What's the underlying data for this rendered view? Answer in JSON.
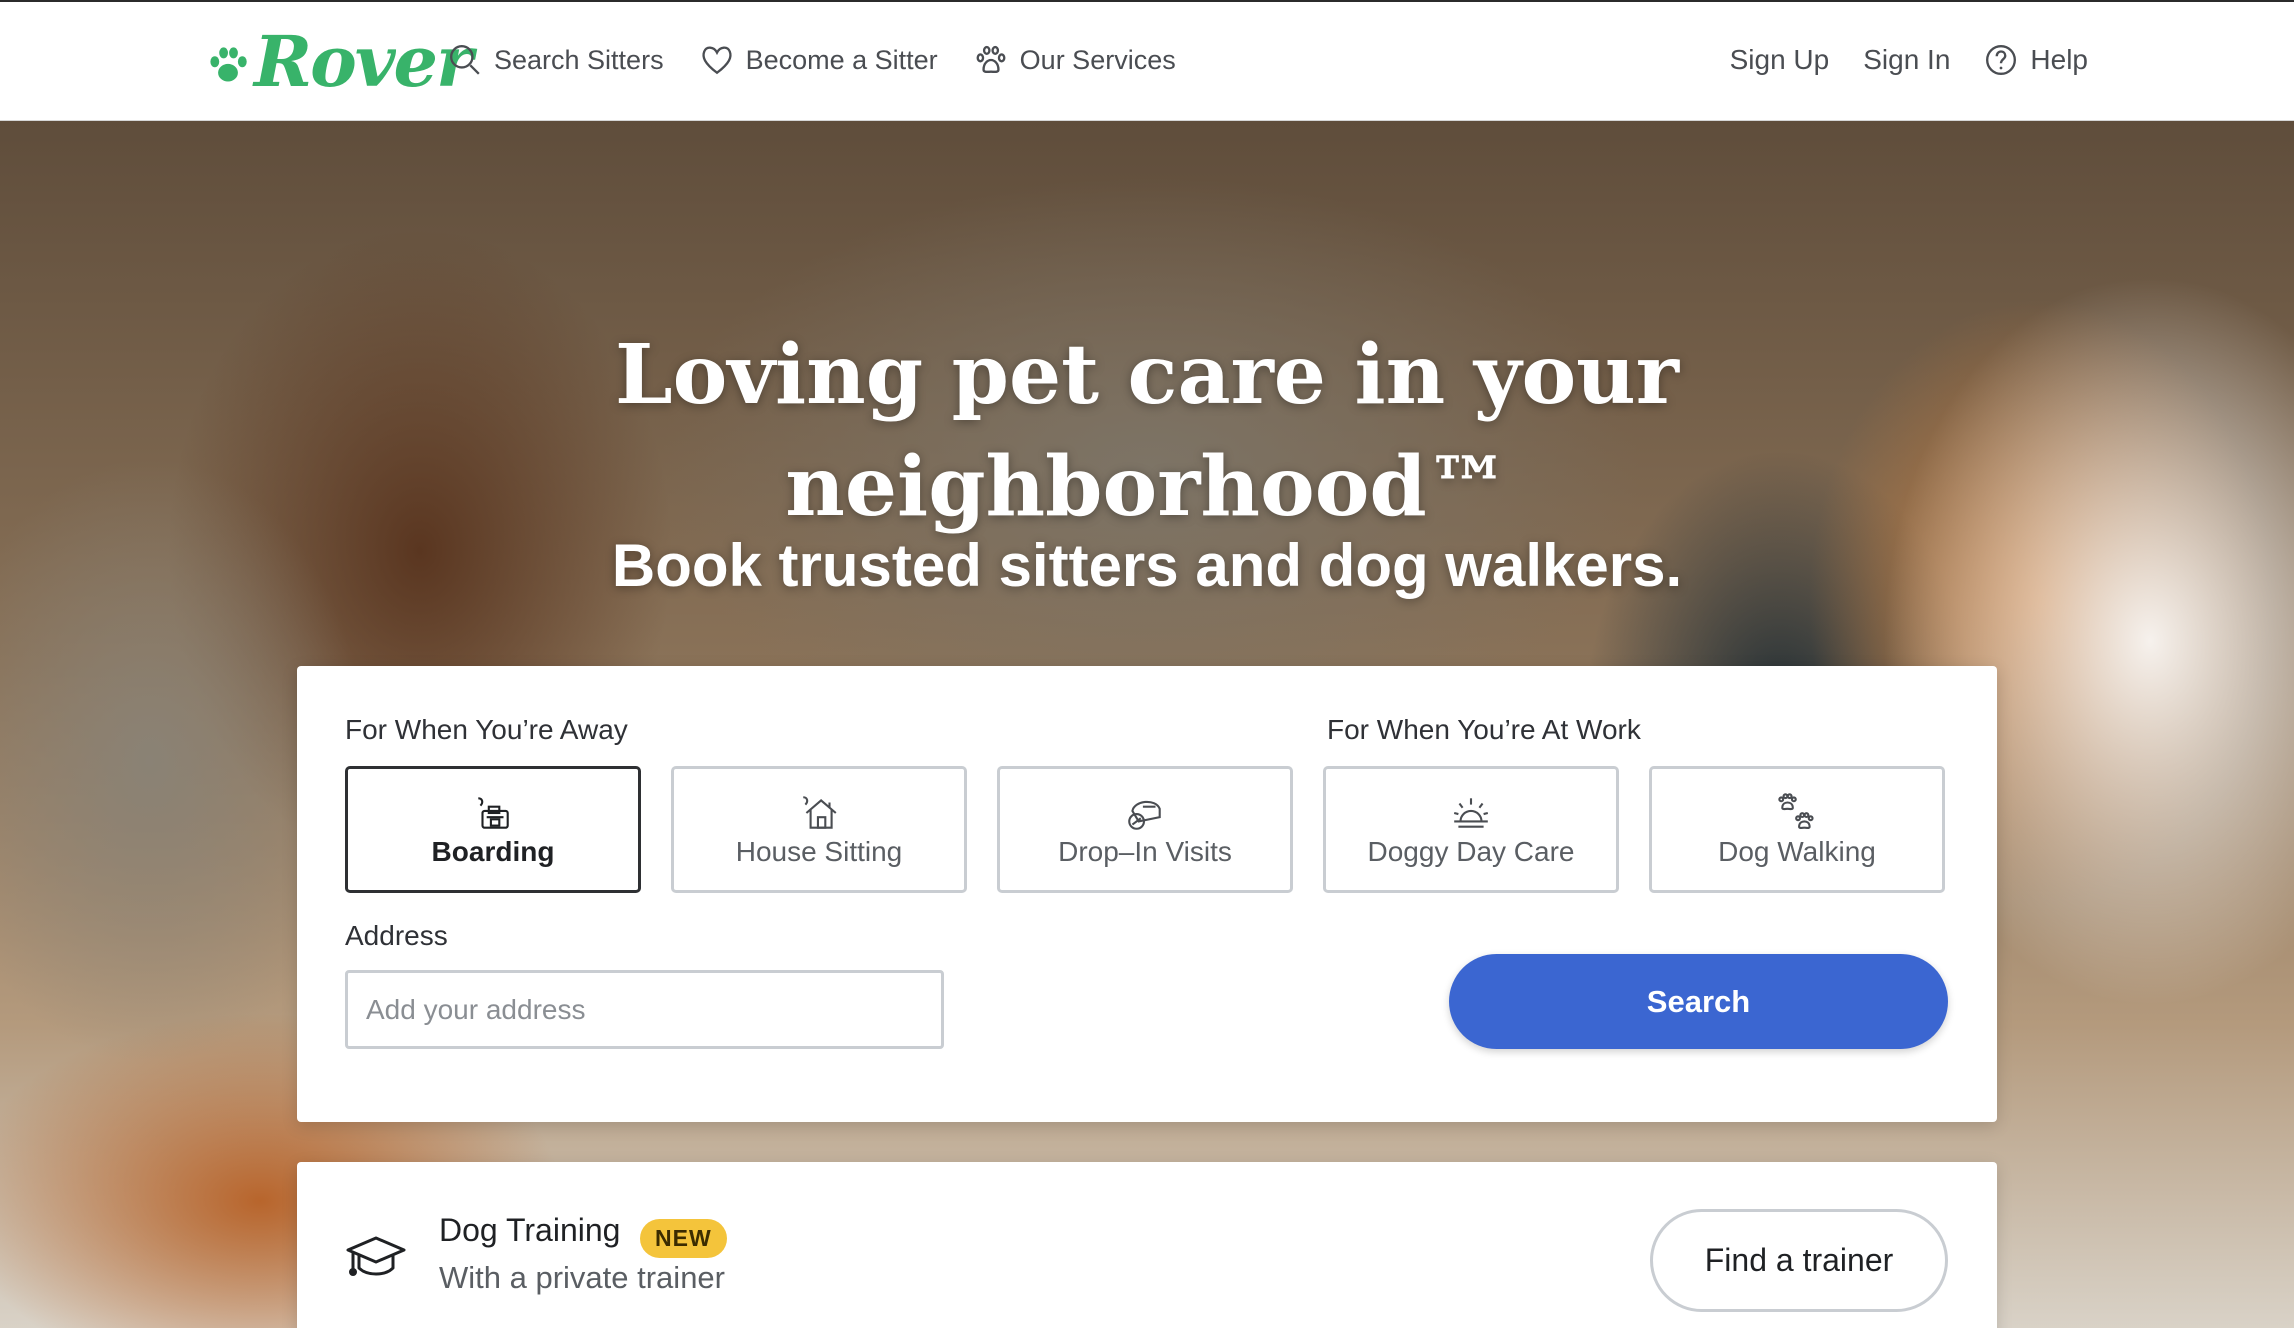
{
  "header": {
    "logo_text": "Rover",
    "nav_left": [
      {
        "label": "Search Sitters",
        "icon": "search-icon"
      },
      {
        "label": "Become a Sitter",
        "icon": "heart-icon"
      },
      {
        "label": "Our Services",
        "icon": "paw-icon"
      }
    ],
    "nav_right": [
      {
        "label": "Sign Up"
      },
      {
        "label": "Sign In"
      },
      {
        "label": "Help",
        "icon": "help-icon"
      }
    ]
  },
  "hero": {
    "title_line1": "Loving pet care in your",
    "title_line2": "neighborhood™",
    "subtitle": "Book trusted sitters and dog walkers."
  },
  "search": {
    "away_label": "For When You’re Away",
    "work_label": "For When You’re At Work",
    "services": [
      {
        "label": "Boarding",
        "icon": "boarding-icon",
        "selected": true
      },
      {
        "label": "House Sitting",
        "icon": "house-icon",
        "selected": false
      },
      {
        "label": "Drop–In Visits",
        "icon": "bowl-icon",
        "selected": false
      },
      {
        "label": "Doggy Day Care",
        "icon": "sun-icon",
        "selected": false
      },
      {
        "label": "Dog Walking",
        "icon": "paws-icon",
        "selected": false
      }
    ],
    "address_label": "Address",
    "address_placeholder": "Add your address",
    "address_value": "",
    "search_label": "Search"
  },
  "training": {
    "title": "Dog Training",
    "badge": "NEW",
    "subtitle": "With a private trainer",
    "button": "Find a trainer",
    "icon": "graduation-cap-icon"
  },
  "colors": {
    "brand": "#38b36a",
    "primary_button": "#3b66d1",
    "badge": "#f4c43b"
  }
}
